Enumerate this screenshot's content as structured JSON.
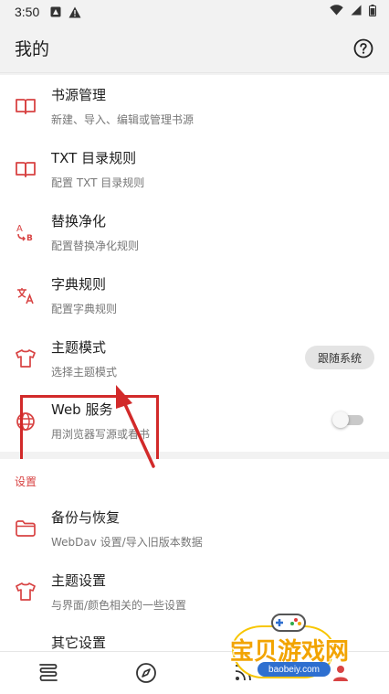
{
  "status_bar": {
    "time": "3:50"
  },
  "app_bar": {
    "title": "我的"
  },
  "main_items": [
    {
      "title": "书源管理",
      "subtitle": "新建、导入、编辑或管理书源",
      "icon": "book-icon"
    },
    {
      "title": "TXT 目录规则",
      "subtitle": "配置 TXT 目录规则",
      "icon": "book-icon"
    },
    {
      "title": "替换净化",
      "subtitle": "配置替换净化规则",
      "icon": "replace-ab-icon"
    },
    {
      "title": "字典规则",
      "subtitle": "配置字典规则",
      "icon": "translate-icon"
    },
    {
      "title": "主题模式",
      "subtitle": "选择主题模式",
      "icon": "shirt-icon",
      "value": "跟随系统"
    },
    {
      "title": "Web 服务",
      "subtitle": "用浏览器写源或看书",
      "icon": "globe-icon",
      "toggle_on": false
    }
  ],
  "settings": {
    "section_title": "设置",
    "items": [
      {
        "title": "备份与恢复",
        "subtitle": "WebDav 设置/导入旧版本数据",
        "icon": "folder-icon"
      },
      {
        "title": "主题设置",
        "subtitle": "与界面/颜色相关的一些设置",
        "icon": "shirt-icon"
      },
      {
        "title": "其它设置",
        "subtitle": "",
        "icon": "gear-icon"
      }
    ]
  },
  "watermark": {
    "text": "宝贝游戏网",
    "url": "baobeiy.com"
  },
  "colors": {
    "accent": "#d84343",
    "highlight": "#d22a2a",
    "background": "#f2f2f2",
    "card": "#ffffff"
  }
}
